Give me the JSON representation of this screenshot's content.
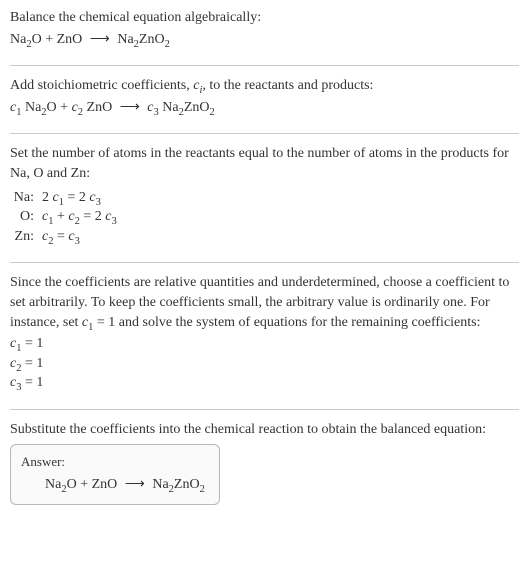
{
  "section1": {
    "title": "Balance the chemical equation algebraically:",
    "eq_left1": "Na",
    "eq_sub1": "2",
    "eq_left2": "O + ZnO ",
    "arrow": "⟶",
    "eq_right1": " Na",
    "eq_sub2": "2",
    "eq_right2": "ZnO",
    "eq_sub3": "2"
  },
  "section2": {
    "title_a": "Add stoichiometric coefficients, ",
    "title_ci": "c",
    "title_i": "i",
    "title_b": ", to the reactants and products:",
    "c1": "c",
    "s1": "1",
    "t1": " Na",
    "s2": "2",
    "t2": "O + ",
    "c2": "c",
    "s3": "2",
    "t3": " ZnO ",
    "arrow": "⟶",
    "t4": " ",
    "c3": "c",
    "s4": "3",
    "t5": " Na",
    "s5": "2",
    "t6": "ZnO",
    "s6": "2"
  },
  "section3": {
    "title": "Set the number of atoms in the reactants equal to the number of atoms in the products for Na, O and Zn:",
    "rows": [
      {
        "label": "Na:",
        "e_a": "2 ",
        "e_c1": "c",
        "e_s1": "1",
        "e_b": " = 2 ",
        "e_c2": "c",
        "e_s2": "3",
        "e_c3": "",
        "e_s3": "",
        "e_d": ""
      },
      {
        "label": "O:",
        "e_a": "",
        "e_c1": "c",
        "e_s1": "1",
        "e_b": " + ",
        "e_c2": "c",
        "e_s2": "2",
        "e_c3": "c",
        "e_s3": "3",
        "e_d": " = 2 "
      },
      {
        "label": "Zn:",
        "e_a": "",
        "e_c1": "c",
        "e_s1": "2",
        "e_b": " = ",
        "e_c2": "c",
        "e_s2": "3",
        "e_c3": "",
        "e_s3": "",
        "e_d": ""
      }
    ]
  },
  "section4": {
    "text_a": "Since the coefficients are relative quantities and underdetermined, choose a coefficient to set arbitrarily. To keep the coefficients small, the arbitrary value is ordinarily one. For instance, set ",
    "c": "c",
    "s": "1",
    "text_b": " = 1 and solve the system of equations for the remaining coefficients:",
    "coefs": [
      {
        "c": "c",
        "s": "1",
        "v": " = 1"
      },
      {
        "c": "c",
        "s": "2",
        "v": " = 1"
      },
      {
        "c": "c",
        "s": "3",
        "v": " = 1"
      }
    ]
  },
  "section5": {
    "title": "Substitute the coefficients into the chemical reaction to obtain the balanced equation:",
    "answer_label": "Answer:",
    "eq_left1": "Na",
    "eq_sub1": "2",
    "eq_left2": "O + ZnO ",
    "arrow": "⟶",
    "eq_right1": " Na",
    "eq_sub2": "2",
    "eq_right2": "ZnO",
    "eq_sub3": "2"
  }
}
